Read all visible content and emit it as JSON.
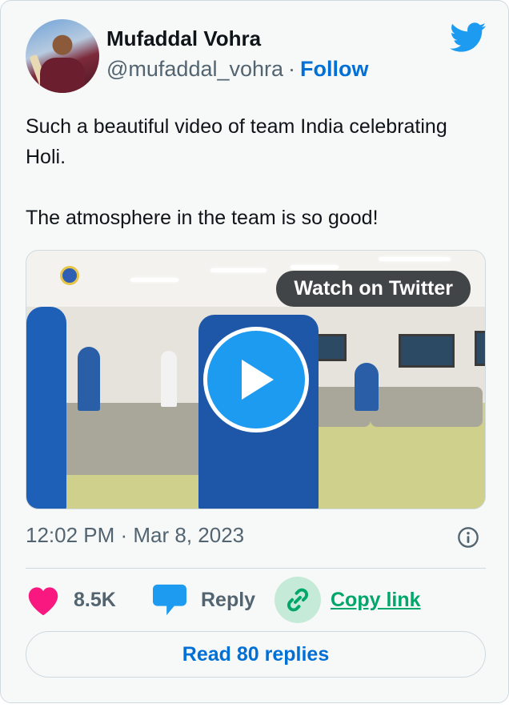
{
  "author": {
    "name": "Mufaddal Vohra",
    "handle": "@mufaddal_vohra",
    "separator": "·",
    "follow_label": "Follow"
  },
  "tweet": {
    "text": "Such a beautiful video of team India celebrating Holi.\n\nThe atmosphere in the team is so good!"
  },
  "media": {
    "watch_label": "Watch on Twitter",
    "play_icon": "play-icon"
  },
  "meta": {
    "timestamp": "12:02 PM · Mar 8, 2023",
    "info_icon": "info-icon"
  },
  "actions": {
    "like_count": "8.5K",
    "reply_label": "Reply",
    "copy_label": "Copy link"
  },
  "footer": {
    "read_replies_label": "Read 80 replies"
  },
  "colors": {
    "brand_blue": "#1d9bf0",
    "like_pink": "#f91880",
    "copy_green": "#00a66a",
    "link_blue": "#006fd6"
  }
}
